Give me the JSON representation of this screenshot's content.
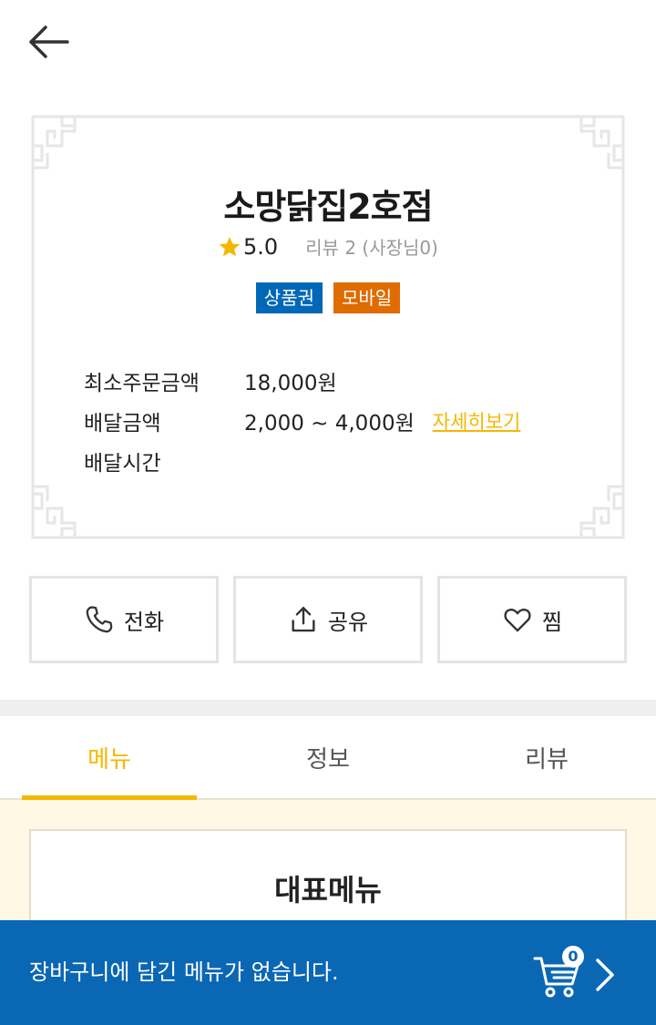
{
  "header": {
    "back_icon": "arrow-left-icon"
  },
  "store": {
    "name": "소망닭집2호점",
    "rating": "5.0",
    "review_info": "리뷰 2 (사장님0)",
    "badges": [
      {
        "label": "상품권",
        "color": "#0068b7"
      },
      {
        "label": "모바일",
        "color": "#e06b00"
      }
    ],
    "info": [
      {
        "label": "최소주문금액",
        "value": "18,000원"
      },
      {
        "label": "배달금액",
        "value": "2,000 ~ 4,000원",
        "link": "자세히보기"
      },
      {
        "label": "배달시간",
        "value": ""
      }
    ]
  },
  "actions": [
    {
      "label": "전화",
      "icon": "phone-icon"
    },
    {
      "label": "공유",
      "icon": "share-icon"
    },
    {
      "label": "찜",
      "icon": "heart-icon"
    }
  ],
  "tabs": [
    {
      "label": "메뉴",
      "active": true
    },
    {
      "label": "정보",
      "active": false
    },
    {
      "label": "리뷰",
      "active": false
    }
  ],
  "menu": {
    "section_title": "대표메뉴"
  },
  "cart": {
    "message": "장바구니에 담긴 메뉴가 없습니다.",
    "count": "0",
    "icon": "cart-icon"
  },
  "colors": {
    "accent": "#f5b800",
    "cart_bar": "#0a67b3",
    "tab_area_bg": "#fff8e4"
  }
}
